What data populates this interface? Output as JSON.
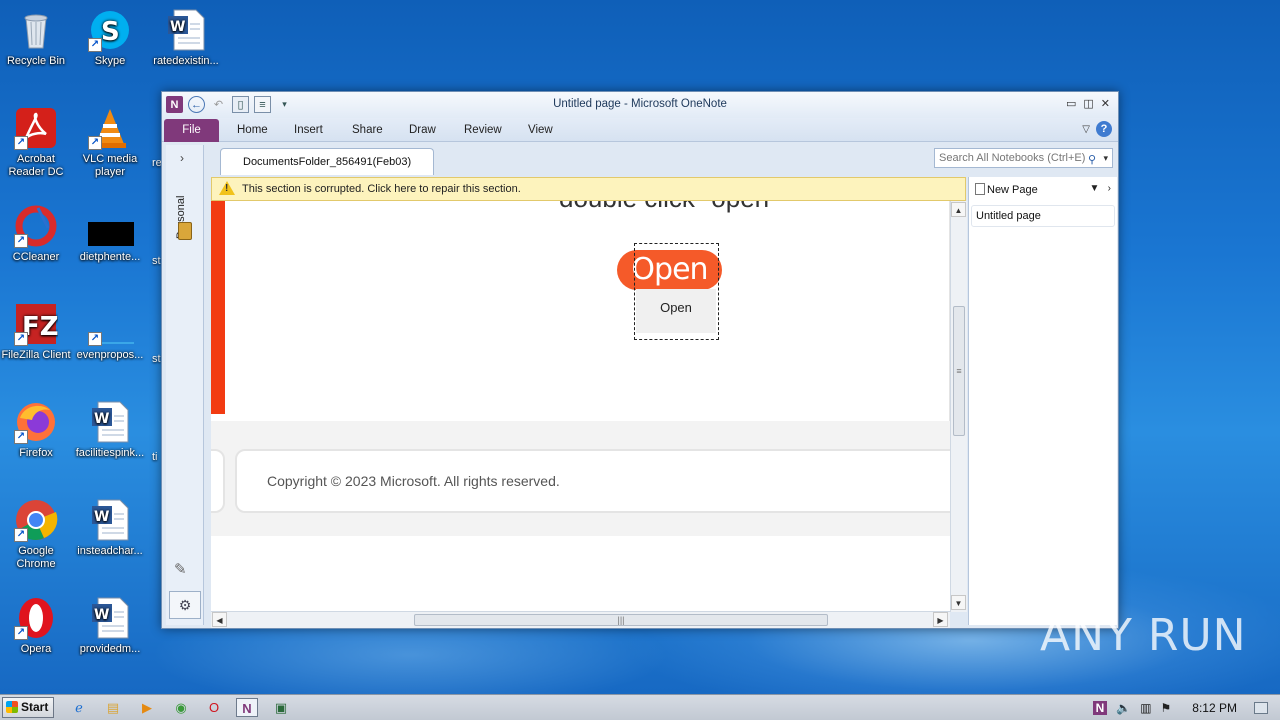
{
  "desktop": {
    "icons": [
      {
        "label": "Recycle Bin",
        "icon": "recycle-bin-icon"
      },
      {
        "label": "Skype",
        "icon": "skype-icon"
      },
      {
        "label": "ratedexistin...",
        "icon": "word-document-icon"
      },
      {
        "label": "Acrobat Reader DC",
        "icon": "acrobat-icon"
      },
      {
        "label": "VLC media player",
        "icon": "vlc-icon"
      },
      {
        "label": "CCleaner",
        "icon": "ccleaner-icon"
      },
      {
        "label": "dietphente...",
        "icon": "black-file-icon"
      },
      {
        "label": "FileZilla Client",
        "icon": "filezilla-icon"
      },
      {
        "label": "evenpropos...",
        "icon": "blue-file-icon"
      },
      {
        "label": "Firefox",
        "icon": "firefox-icon"
      },
      {
        "label": "facilitiespink...",
        "icon": "word-document-icon"
      },
      {
        "label": "Google Chrome",
        "icon": "chrome-icon"
      },
      {
        "label": "insteadchar...",
        "icon": "word-document-icon"
      },
      {
        "label": "Opera",
        "icon": "opera-icon"
      },
      {
        "label": "providedm...",
        "icon": "word-document-icon"
      }
    ],
    "clipped_labels": [
      "re",
      "st",
      "st",
      "ti"
    ]
  },
  "window": {
    "title": "Untitled page  -  Microsoft OneNote",
    "ribbon_tabs": [
      "File",
      "Home",
      "Insert",
      "Share",
      "Draw",
      "Review",
      "View"
    ],
    "notebook_label": "Personal",
    "section_tab": "DocumentsFolder_856491(Feb03)",
    "search_placeholder": "Search All Notebooks (Ctrl+E)",
    "warning": "This section is corrupted. Click here to repair this section.",
    "page": {
      "heading": "double click \"open\"",
      "pill_label": "Open",
      "button_label": "Open",
      "copyright": "Copyright © 2023 Microsoft. All rights reserved."
    },
    "pages_pane": {
      "new_page_label": "New Page",
      "pages": [
        "Untitled page"
      ]
    }
  },
  "taskbar": {
    "start_label": "Start",
    "clock": "8:12 PM"
  },
  "watermark": "ANY RUN",
  "colors": {
    "onenote_purple": "#80397b",
    "accent_red": "#f23b12",
    "pill_orange": "#f55a29",
    "warning_yellow": "#fdf3bd"
  }
}
